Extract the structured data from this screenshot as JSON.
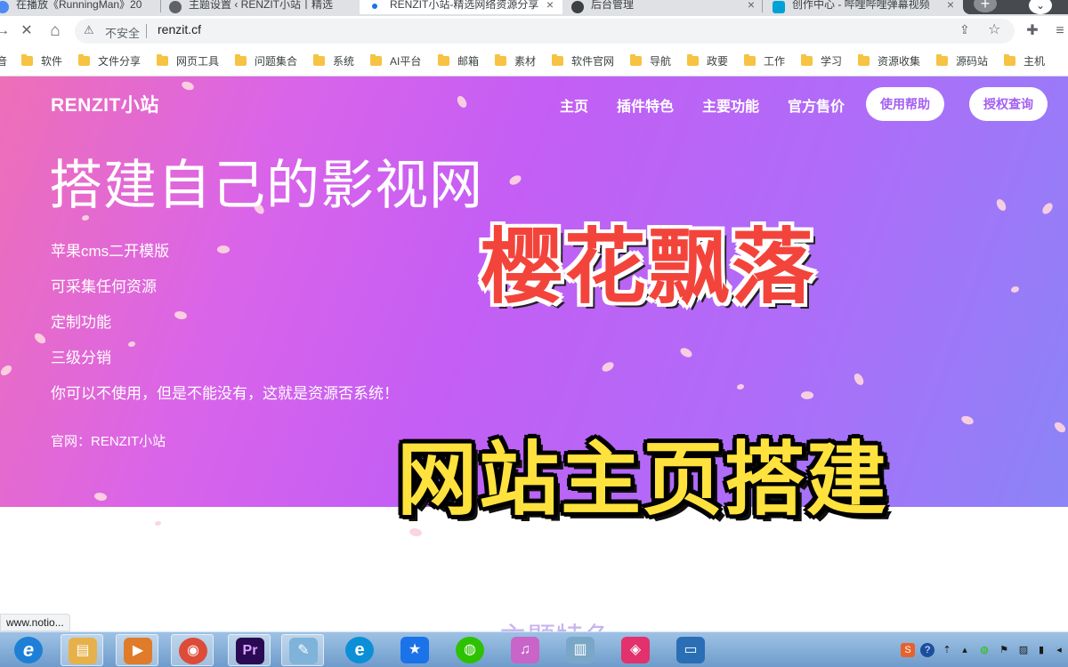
{
  "tabs": [
    {
      "title": "在播放《RunningMan》20",
      "favicon_color": "#4c8bf5",
      "active": false
    },
    {
      "title": "主题设置 ‹ RENZIT小站丨精选",
      "favicon_color": "#5f6368",
      "active": false
    },
    {
      "title": "RENZIT小站-精选网络资源分享",
      "favicon_color": "#1a73e8",
      "active": true
    },
    {
      "title": "后台管理",
      "favicon_color": "#3c4043",
      "active": false
    },
    {
      "title": "创作中心 - 哔哩哔哩弹幕视频",
      "favicon_color": "#00a1d6",
      "active": false
    }
  ],
  "tab_close_glyph": "×",
  "newtab_glyph": "+",
  "tab_menu_glyph": "⌄",
  "toolbar": {
    "forward_glyph": "→",
    "stop_glyph": "✕",
    "home_glyph": "⌂",
    "security_glyph": "⚠",
    "insecure_label": "不安全",
    "url": "renzit.cf",
    "share_glyph": "⇪",
    "star_glyph": "☆",
    "extensions_glyph": "✚",
    "reading_glyph": "≡"
  },
  "bookmarks": [
    "音",
    "软件",
    "文件分享",
    "网页工具",
    "问题集合",
    "系统",
    "AI平台",
    "邮箱",
    "素材",
    "软件官网",
    "导航",
    "政要",
    "工作",
    "学习",
    "资源收集",
    "源码站",
    "主机"
  ],
  "site": {
    "brand": "RENZIT小站",
    "nav": [
      "主页",
      "插件特色",
      "主要功能",
      "官方售价"
    ],
    "buttons": [
      "使用帮助",
      "授权查询"
    ],
    "headline": "搭建自己的影视网",
    "features": [
      "苹果cms二开模版",
      "可采集任何资源",
      "定制功能",
      "三级分销",
      "你可以不使用，但是不能没有，这就是资源否系统！"
    ],
    "site_line": "官网：RENZIT小站",
    "section_peek": "主题特色"
  },
  "overlay": {
    "caption_top": "樱花飘落",
    "caption_bottom": "网站主页搭建"
  },
  "status_url": "www.notio...",
  "colors": {
    "gradient_start": "#ee6fb7",
    "gradient_mid": "#c45ef4",
    "gradient_end": "#8b84f7",
    "pill_text": "#a45ff2",
    "caption_top": "#f3443c",
    "caption_bottom": "#ffe23d",
    "petal": "#fbd3df"
  },
  "taskbar": {
    "apps": [
      {
        "name": "internet-explorer",
        "glyph": "e",
        "color": "#1e7fd6"
      },
      {
        "name": "file-explorer",
        "glyph": "▤",
        "color": "#e6b14a"
      },
      {
        "name": "media-player",
        "glyph": "▶",
        "color": "#e07b2a"
      },
      {
        "name": "chrome",
        "glyph": "◉",
        "color": "#dd4b39"
      },
      {
        "name": "premiere-pro",
        "glyph": "Pr",
        "color": "#2a0a52"
      },
      {
        "name": "notepad",
        "glyph": "✎",
        "color": "#7fb3d9"
      },
      {
        "name": "edge",
        "glyph": "e",
        "color": "#0c8fd6"
      },
      {
        "name": "todo",
        "glyph": "★",
        "color": "#1a73e8"
      },
      {
        "name": "wechat",
        "glyph": "◍",
        "color": "#2dc100"
      },
      {
        "name": "audio-tool",
        "glyph": "♫",
        "color": "#c964c9"
      },
      {
        "name": "notes",
        "glyph": "▥",
        "color": "#7aa7c7"
      },
      {
        "name": "video-editor",
        "glyph": "◈",
        "color": "#e2316c"
      },
      {
        "name": "screen-tool",
        "glyph": "▭",
        "color": "#2a6fb5"
      }
    ],
    "tray": [
      "S",
      "?",
      "⇡",
      "▴",
      "◍",
      "⚑",
      "▨",
      "▮",
      "◂"
    ]
  }
}
